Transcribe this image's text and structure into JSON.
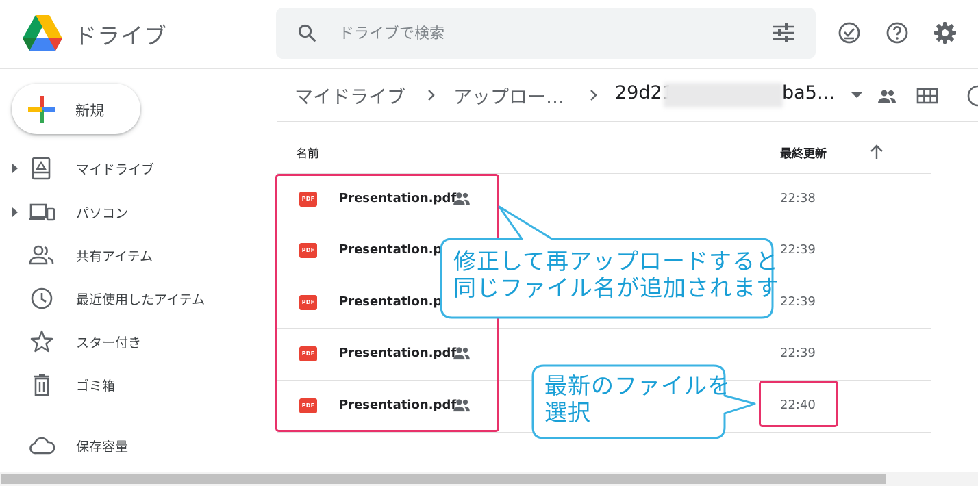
{
  "header": {
    "app_title": "ドライブ",
    "search_placeholder": "ドライブで検索"
  },
  "sidebar": {
    "new_label": "新規",
    "items": [
      {
        "label": "マイドライブ",
        "icon": "my-drive-icon",
        "expandable": true
      },
      {
        "label": "パソコン",
        "icon": "computers-icon",
        "expandable": true
      },
      {
        "label": "共有アイテム",
        "icon": "shared-icon",
        "expandable": false
      },
      {
        "label": "最近使用したアイテム",
        "icon": "clock-icon",
        "expandable": false
      },
      {
        "label": "スター付き",
        "icon": "star-icon",
        "expandable": false
      },
      {
        "label": "ゴミ箱",
        "icon": "trash-icon",
        "expandable": false
      },
      {
        "label": "保存容量",
        "icon": "cloud-icon",
        "expandable": false
      }
    ]
  },
  "breadcrumb": {
    "items": [
      "マイドライブ",
      "アップロー…"
    ],
    "current_start": "29d21",
    "current_end": "ba5…"
  },
  "table": {
    "columns": {
      "name": "名前",
      "modified": "最終更新"
    },
    "rows": [
      {
        "name": "Presentation.pdf",
        "modified": "22:38"
      },
      {
        "name": "Presentation.pdf",
        "modified": "22:39"
      },
      {
        "name": "Presentation.pdf",
        "modified": "22:39"
      },
      {
        "name": "Presentation.pdf",
        "modified": "22:39"
      },
      {
        "name": "Presentation.pdf",
        "modified": "22:40"
      }
    ]
  },
  "annotations": {
    "callout1_line1": "修正して再アップロードすると",
    "callout1_line2": "同じファイル名が追加されます",
    "callout2_line1": "最新のファイルを",
    "callout2_line2": "選択"
  },
  "colors": {
    "highlight": "#e8326a",
    "callout_border": "#3bb3e3",
    "callout_text": "#1a9fd6",
    "pdf_red": "#ea4335"
  }
}
